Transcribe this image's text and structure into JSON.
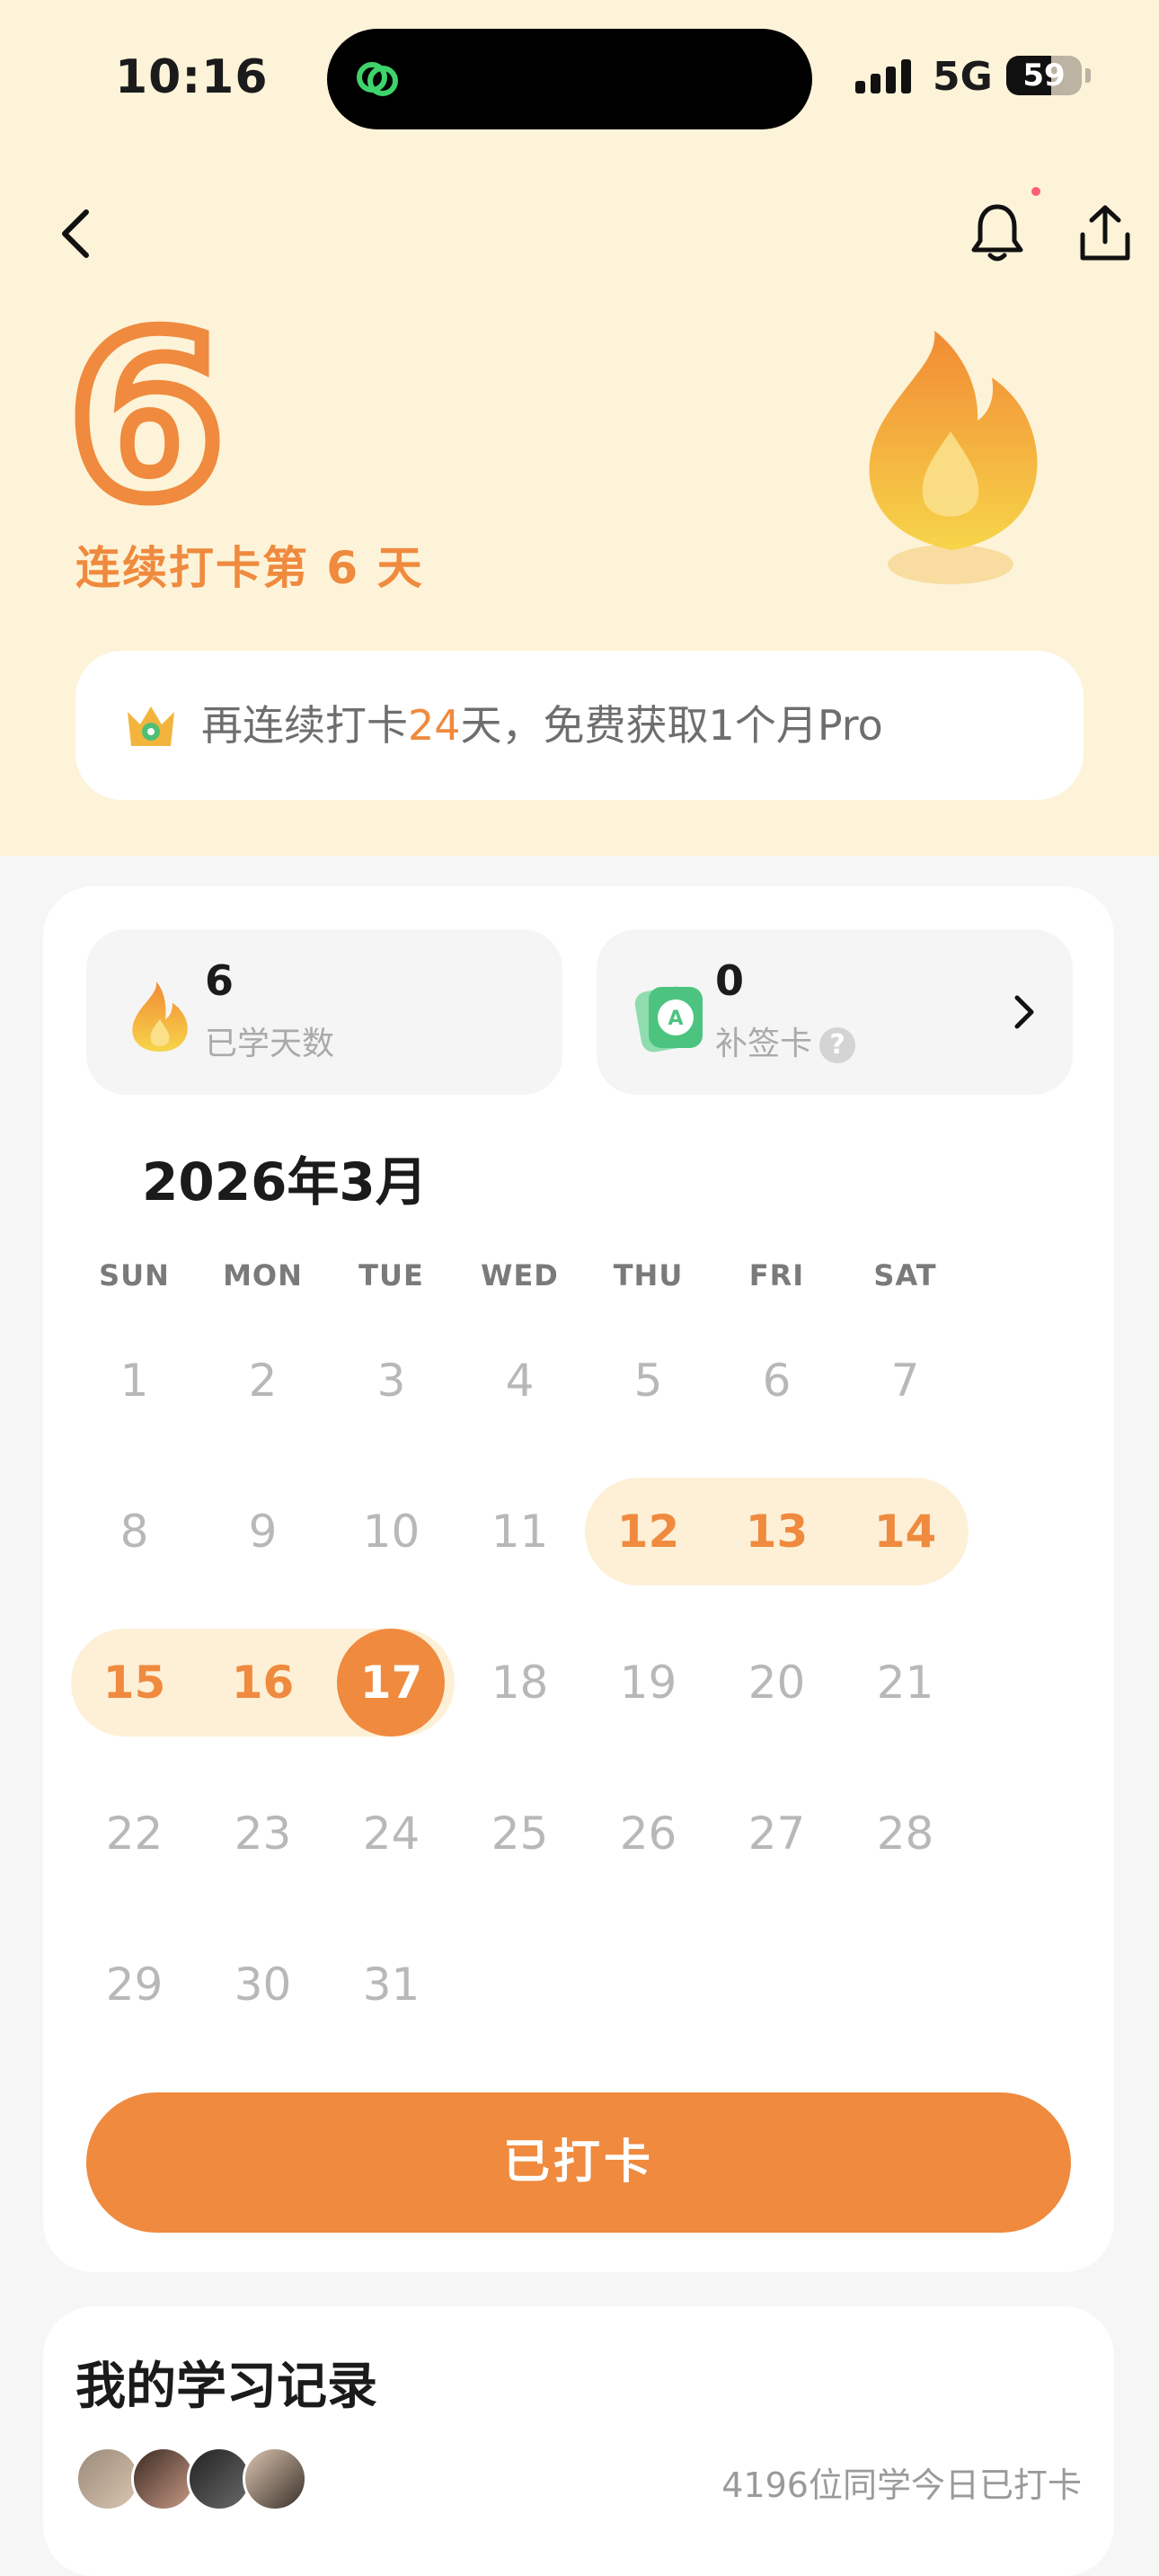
{
  "status_bar": {
    "time": "10:16",
    "network": "5G",
    "battery": "59",
    "battery_level": 0.59
  },
  "streak": {
    "number": "6",
    "label": "连续打卡第 6 天"
  },
  "promo": {
    "text_before": "再连续打卡",
    "highlight": "24",
    "text_after": "天，免费获取1个月Pro"
  },
  "stats": {
    "days_learned": {
      "value": "6",
      "label": "已学天数"
    },
    "makeup_cards": {
      "value": "0",
      "label": "补签卡",
      "help": "?"
    }
  },
  "calendar": {
    "month_title": "2026年3月",
    "weekdays": [
      "SUN",
      "MON",
      "TUE",
      "WED",
      "THU",
      "FRI",
      "SAT"
    ],
    "first_weekday_index": 0,
    "days_in_month": 31,
    "checked_days": [
      12,
      13,
      14,
      15,
      16,
      17
    ],
    "today": 17
  },
  "checkin_button": {
    "label": "已打卡"
  },
  "records": {
    "title": "我的学习记录",
    "count_text": "4196位同学今日已打卡"
  },
  "colors": {
    "accent": "#ef8a3e",
    "highlight_bg": "#fdf0d6",
    "header_bg": "#fdf3d8"
  }
}
